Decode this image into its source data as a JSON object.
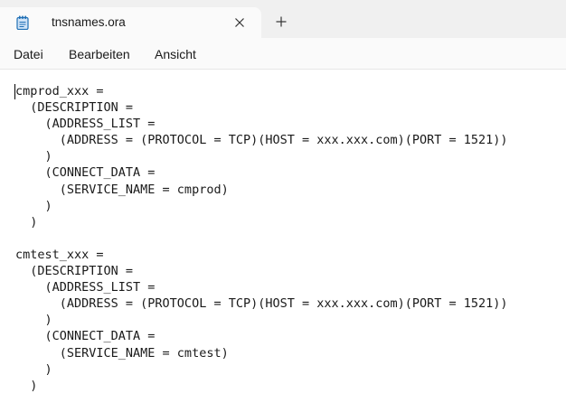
{
  "tab": {
    "title": "tnsnames.ora",
    "icon": "notepad-icon",
    "close_icon": "close-icon"
  },
  "new_tab": {
    "icon": "plus-icon",
    "label": "+"
  },
  "menu": {
    "items": [
      {
        "label": "Datei"
      },
      {
        "label": "Bearbeiten"
      },
      {
        "label": "Ansicht"
      }
    ]
  },
  "editor": {
    "content": "cmprod_xxx =\n  (DESCRIPTION =\n    (ADDRESS_LIST =\n      (ADDRESS = (PROTOCOL = TCP)(HOST = xxx.xxx.com)(PORT = 1521))\n    )\n    (CONNECT_DATA =\n      (SERVICE_NAME = cmprod)\n    )\n  )\n\ncmtest_xxx =\n  (DESCRIPTION =\n    (ADDRESS_LIST =\n      (ADDRESS = (PROTOCOL = TCP)(HOST = xxx.xxx.com)(PORT = 1521))\n    )\n    (CONNECT_DATA =\n      (SERVICE_NAME = cmtest)\n    )\n  )"
  },
  "colors": {
    "tabstrip_bg": "#f0f0f0",
    "tab_bg": "#fafafa",
    "editor_bg": "#ffffff",
    "text": "#1a1a1a",
    "icon_accent": "#1f6fb5"
  }
}
